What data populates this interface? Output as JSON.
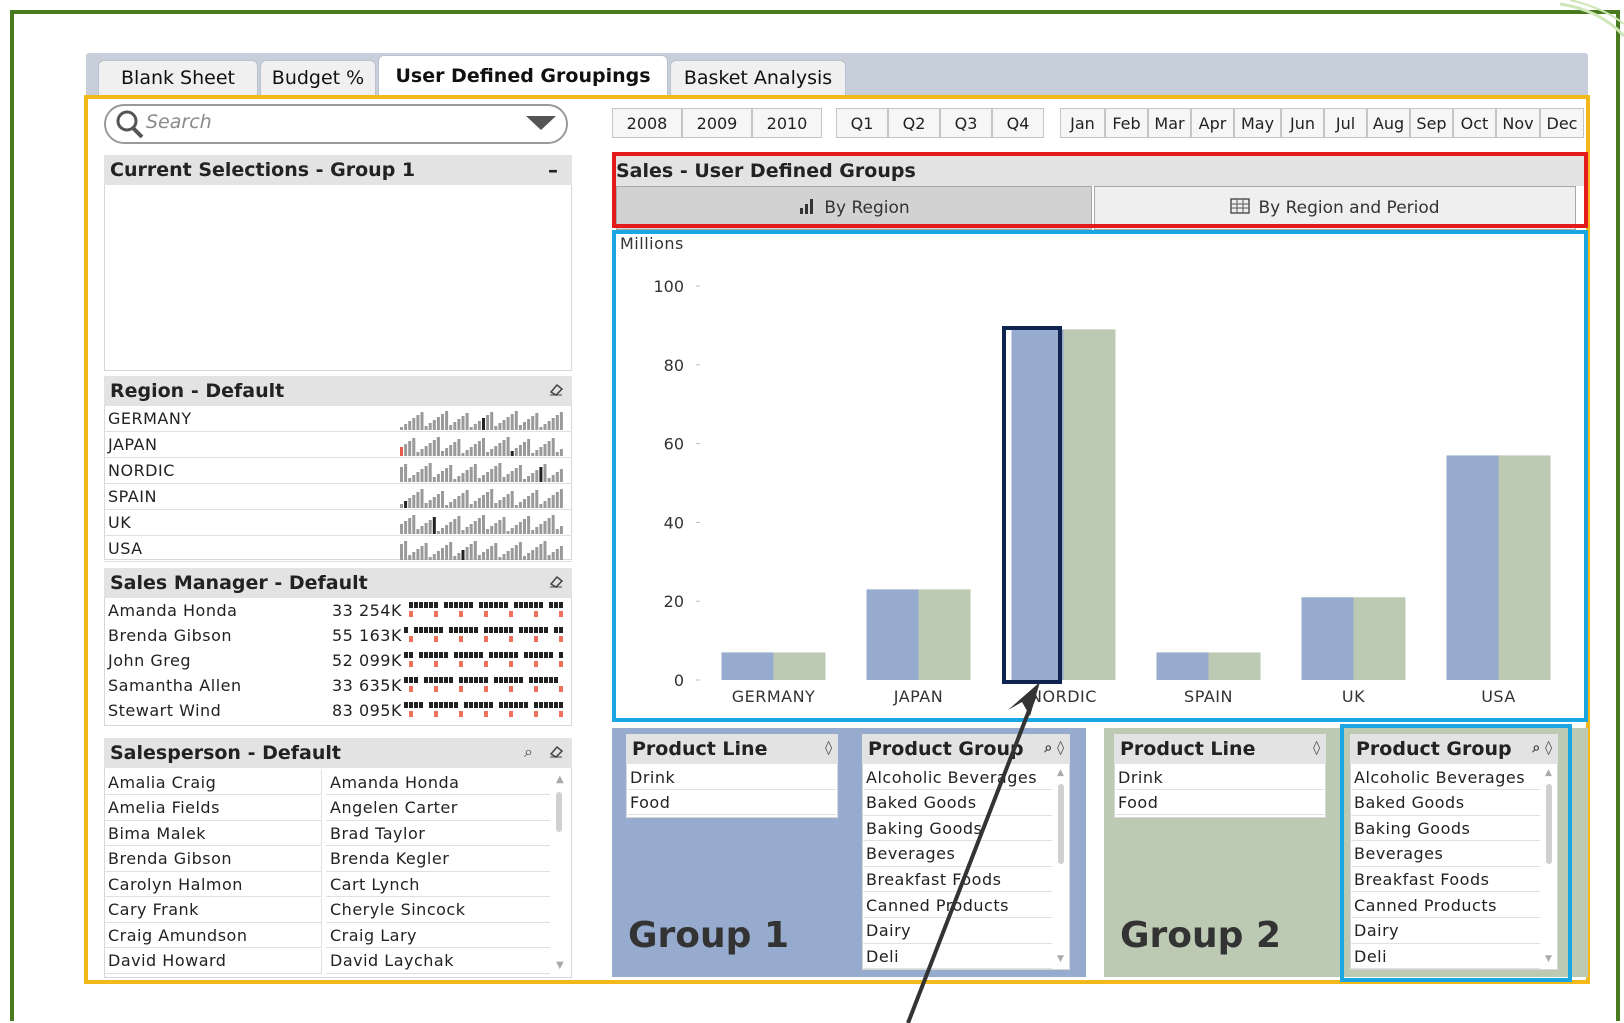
{
  "tabs": [
    "Blank Sheet",
    "Budget %",
    "User Defined Groupings",
    "Basket Analysis"
  ],
  "active_tab": "User Defined Groupings",
  "search": {
    "placeholder": "Search"
  },
  "current_selections": {
    "title": "Current Selections - Group 1",
    "collapse_label": "–"
  },
  "region": {
    "title": "Region - Default",
    "items": [
      "GERMANY",
      "JAPAN",
      "NORDIC",
      "SPAIN",
      "UK",
      "USA"
    ]
  },
  "sales_manager": {
    "title": "Sales Manager - Default",
    "items": [
      {
        "name": "Amanda Honda",
        "value": "33 254K"
      },
      {
        "name": "Brenda Gibson",
        "value": "55 163K"
      },
      {
        "name": "John Greg",
        "value": "52 099K"
      },
      {
        "name": "Samantha Allen",
        "value": "33 635K"
      },
      {
        "name": "Stewart Wind",
        "value": "83 095K"
      }
    ]
  },
  "salesperson": {
    "title": "Salesperson - Default",
    "col1": [
      "Amalia Craig",
      "Amelia Fields",
      "Bima Malek",
      "Brenda Gibson",
      "Carolyn Halmon",
      "Cary Frank",
      "Craig Amundson",
      "David Howard"
    ],
    "col2": [
      "Amanda Honda",
      "Angelen Carter",
      "Brad Taylor",
      "Brenda Kegler",
      "Cart Lynch",
      "Cheryle Sincock",
      "Craig Lary",
      "David Laychak"
    ]
  },
  "time_filters": {
    "years": [
      "2008",
      "2009",
      "2010"
    ],
    "quarters": [
      "Q1",
      "Q2",
      "Q3",
      "Q4"
    ],
    "months": [
      "Jan",
      "Feb",
      "Mar",
      "Apr",
      "May",
      "Jun",
      "Jul",
      "Aug",
      "Sep",
      "Oct",
      "Nov",
      "Dec"
    ]
  },
  "chart_panel": {
    "title": "Sales - User Defined Groups",
    "tab_by_region": "By Region",
    "tab_by_region_period": "By Region and Period"
  },
  "chart_data": {
    "type": "bar",
    "ylabel": "Millions",
    "ylim": [
      0,
      100
    ],
    "yticks": [
      0,
      20,
      40,
      60,
      80,
      100
    ],
    "categories": [
      "GERMANY",
      "JAPAN",
      "NORDIC",
      "SPAIN",
      "UK",
      "USA"
    ],
    "series": [
      {
        "values": [
          7,
          23,
          89,
          7,
          21,
          57
        ]
      },
      {
        "values": [
          7,
          23,
          89,
          7,
          21,
          57
        ]
      }
    ],
    "colors": [
      "#97abcf",
      "#bccab4"
    ]
  },
  "group1": {
    "label": "Group 1",
    "color": "#97abcf",
    "product_line": {
      "title": "Product Line",
      "items": [
        "Drink",
        "Food"
      ]
    },
    "product_group": {
      "title": "Product Group",
      "items": [
        "Alcoholic Beverages",
        "Baked Goods",
        "Baking Goods",
        "Beverages",
        "Breakfast Foods",
        "Canned Products",
        "Dairy",
        "Deli"
      ]
    }
  },
  "group2": {
    "label": "Group 2",
    "color": "#bccab4",
    "product_line": {
      "title": "Product Line",
      "items": [
        "Drink",
        "Food"
      ]
    },
    "product_group": {
      "title": "Product Group",
      "items": [
        "Alcoholic Beverages",
        "Baked Goods",
        "Baking Goods",
        "Beverages",
        "Breakfast Foods",
        "Canned Products",
        "Dairy",
        "Deli"
      ]
    }
  }
}
